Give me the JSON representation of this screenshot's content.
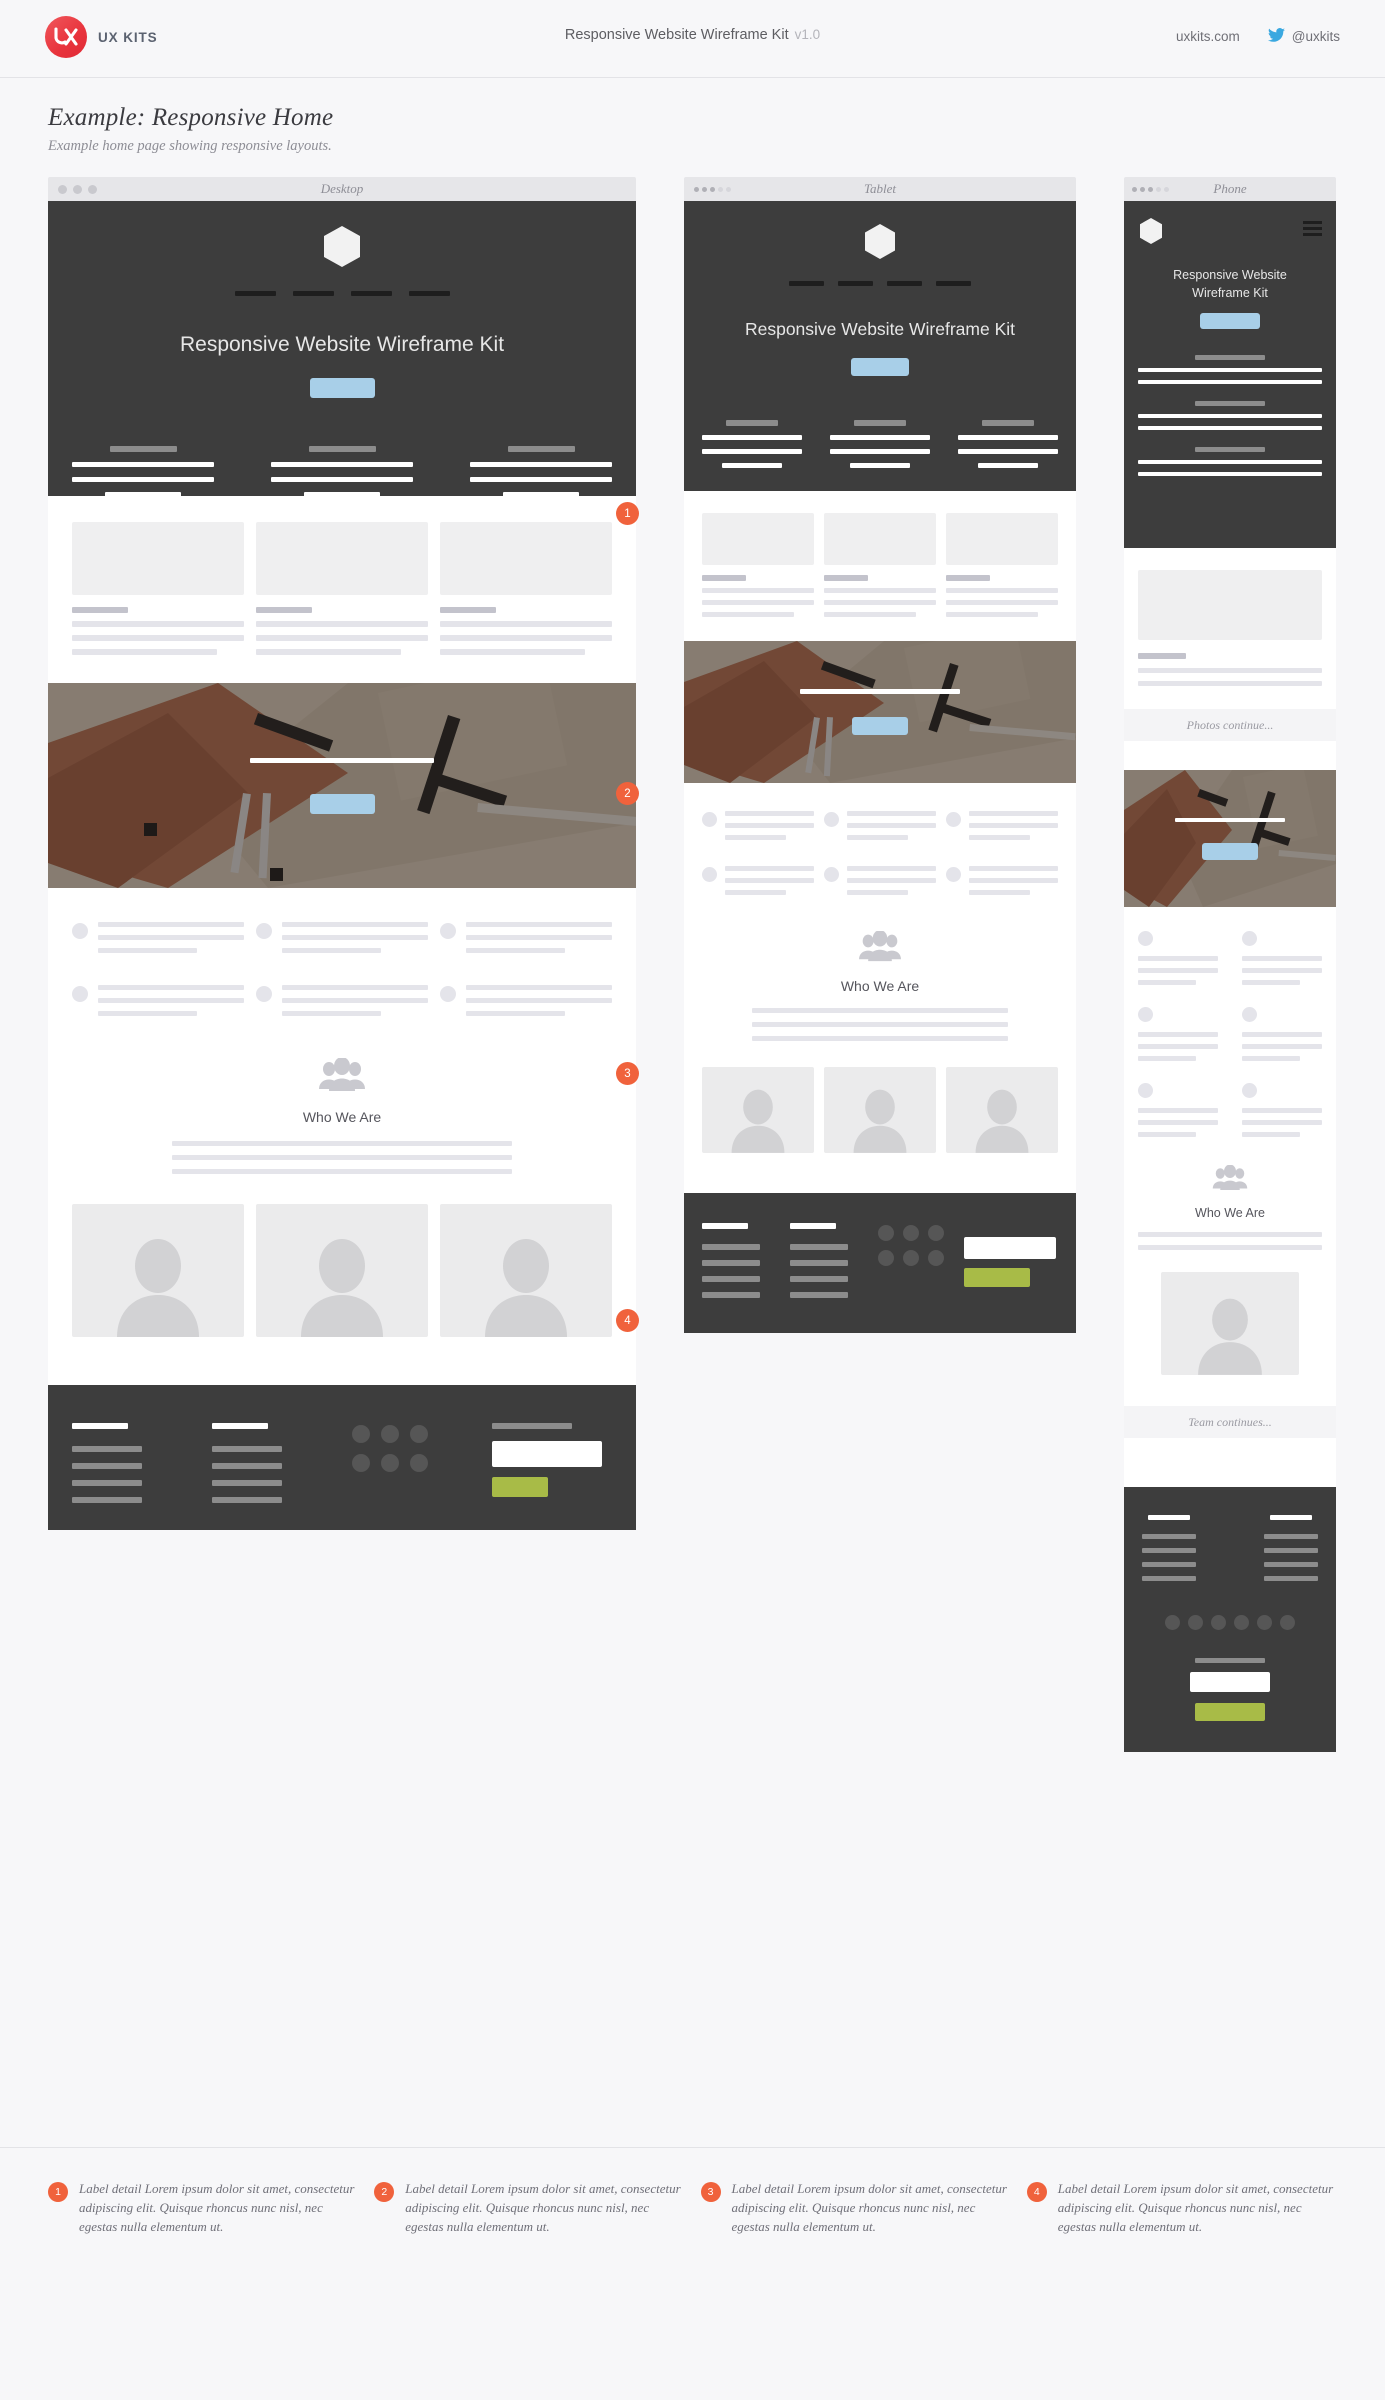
{
  "topbar": {
    "brand_name": "UX KITS",
    "logo_icon": "ux-kits-logo",
    "title": "Responsive Website Wireframe Kit",
    "version": "v1.0",
    "website": "uxkits.com",
    "twitter_icon": "twitter-bird-icon",
    "twitter_handle": "@uxkits"
  },
  "page": {
    "title": "Example: Responsive Home",
    "subtitle": "Example home page showing responsive layouts."
  },
  "devices": {
    "desktop": {
      "label": "Desktop",
      "dots": 3,
      "dot_style": "large"
    },
    "tablet": {
      "label": "Tablet",
      "dots": 5,
      "dot_style": "small"
    },
    "phone": {
      "label": "Phone",
      "dots": 5,
      "dot_style": "small"
    }
  },
  "hero": {
    "logo_icon": "hexagon-logo-icon",
    "menu_icon": "hamburger-menu-icon",
    "headline": "Responsive Website Wireframe Kit",
    "headline_line1": "Responsive Website",
    "headline_line2": "Wireframe Kit",
    "cta_label": "",
    "cta_color": "#a8cfe8",
    "nav_items": 4
  },
  "sections": {
    "who_we_are": {
      "icon": "group-people-icon",
      "heading": "Who We Are"
    },
    "photo_hero": {
      "image_alt": "desk-with-rulers-photo",
      "cta_color": "#a8cfe8"
    },
    "cards": {
      "count": 3,
      "text_lines": 3
    },
    "features": {
      "columns": 3,
      "rows": 2,
      "icon": "bullet-circle-icon"
    },
    "team": {
      "avatars": 3,
      "avatar_icon": "person-avatar-icon"
    }
  },
  "footer": {
    "link_columns": 2,
    "links_per_column": 4,
    "social_icons": 6,
    "social_icon_name": "social-circle-icon",
    "input_placeholder": "",
    "submit_color": "#a8bb47"
  },
  "continuations": {
    "photos": "Photos continue...",
    "team": "Team continues..."
  },
  "callouts": [
    {
      "number": "1"
    },
    {
      "number": "2"
    },
    {
      "number": "3"
    },
    {
      "number": "4"
    }
  ],
  "notes": [
    {
      "number": "1",
      "text": "Label detail Lorem ipsum dolor sit amet, consectetur adipiscing elit. Quisque rhoncus nunc nisl, nec egestas nulla elementum ut."
    },
    {
      "number": "2",
      "text": "Label detail Lorem ipsum dolor sit amet, consectetur adipiscing elit. Quisque rhoncus nunc nisl, nec egestas nulla elementum ut."
    },
    {
      "number": "3",
      "text": "Label detail Lorem ipsum dolor sit amet, consectetur adipiscing elit. Quisque rhoncus nunc nisl, nec egestas nulla elementum ut."
    },
    {
      "number": "4",
      "text": "Label detail Lorem ipsum dolor sit amet, consectetur adipiscing elit. Quisque rhoncus nunc nisl, nec egestas nulla elementum ut."
    }
  ],
  "colors": {
    "accent_orange": "#f0623c",
    "brand_red": "#e8333c",
    "dark_panel": "#3d3d3d",
    "blue_cta": "#a8cfe8",
    "green_cta": "#a8bb47",
    "page_bg": "#f7f7f9"
  }
}
